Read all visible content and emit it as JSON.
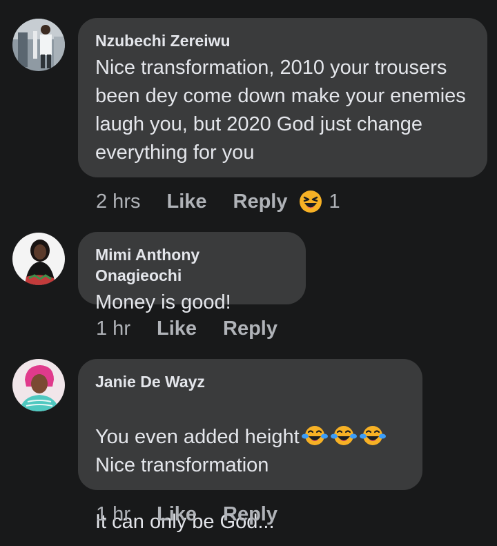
{
  "comments": [
    {
      "author": "Nzubechi Zereiwu",
      "text": "Nice transformation, 2010 your trousers been dey come down make your enemies laugh you, but 2020 God just change everything for you",
      "time": "2 hrs",
      "like_label": "Like",
      "reply_label": "Reply",
      "reaction_icon": "laughing-squint-emoji",
      "reaction_count": "1"
    },
    {
      "author": "Mimi Anthony Onagieochi",
      "text": "Money is good!",
      "time": "1 hr",
      "like_label": "Like",
      "reply_label": "Reply"
    },
    {
      "author": "Janie De Wayz",
      "text_line1": "You even added height",
      "text_line1_emojis": [
        "tears-of-joy-emoji",
        "tears-of-joy-emoji",
        "tears-of-joy-emoji"
      ],
      "text_line2": "Nice transformation",
      "text_line3": "It can only be God...",
      "time": "1 hr",
      "like_label": "Like",
      "reply_label": "Reply"
    }
  ],
  "colors": {
    "background": "#18191a",
    "bubble": "#3a3b3c",
    "primary_text": "#e4e6eb",
    "secondary_text": "#b0b3b8",
    "emoji": "#f7b125"
  }
}
